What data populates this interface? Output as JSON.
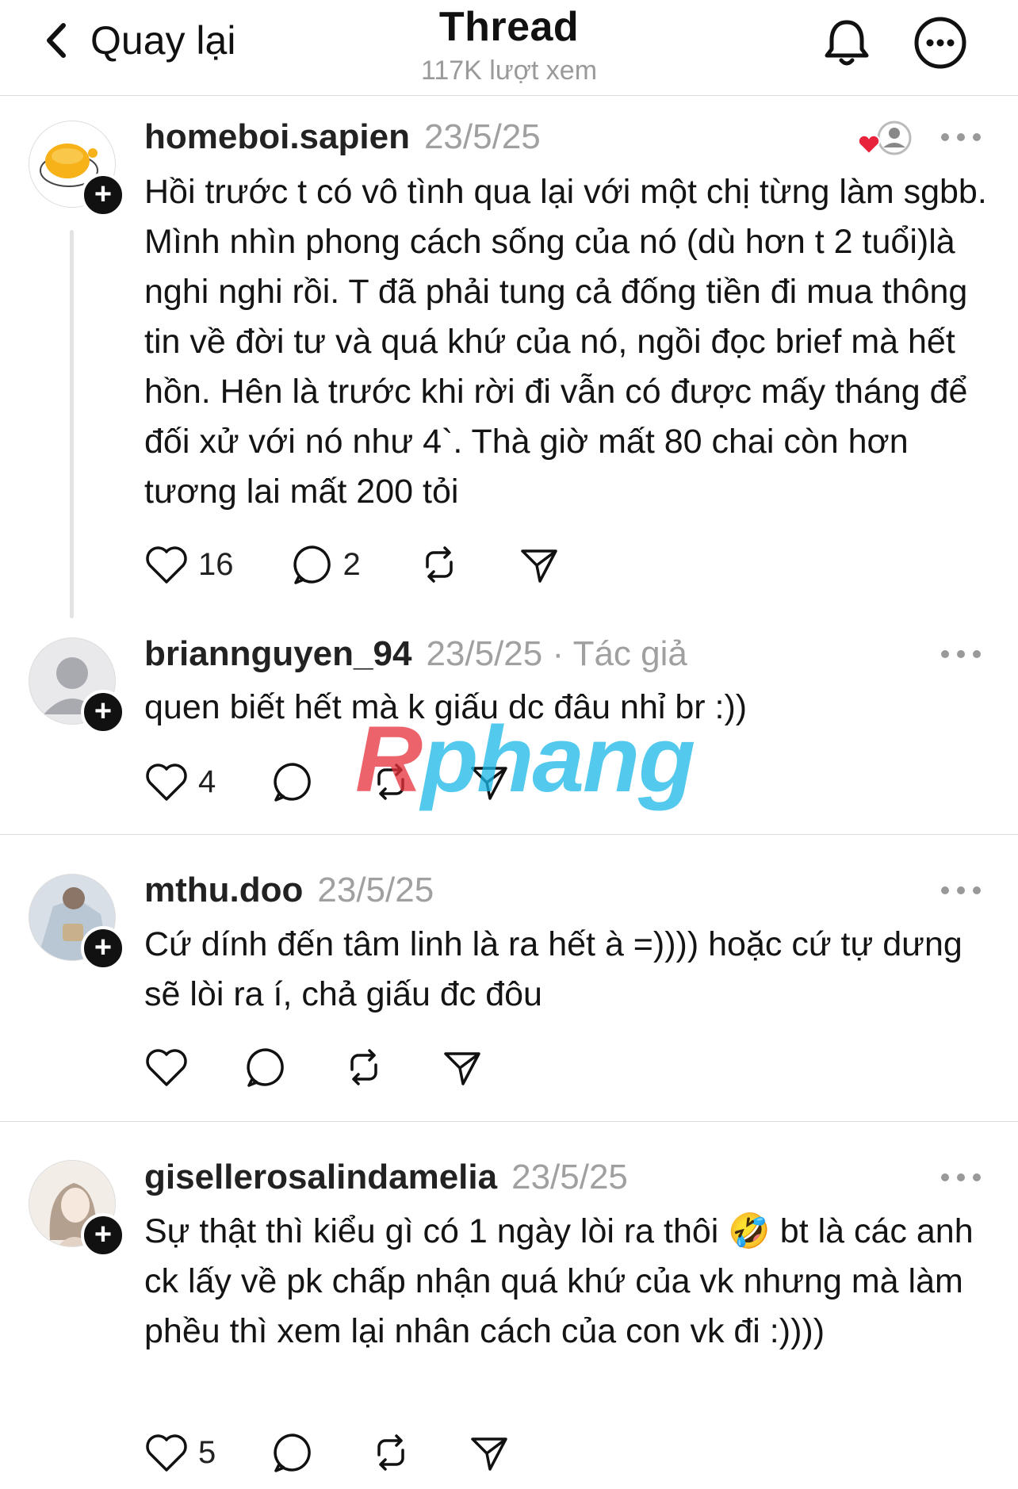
{
  "header": {
    "back_label": "Quay lại",
    "title": "Thread",
    "views": "117K lượt xem"
  },
  "watermark": {
    "part1": "R",
    "part2": "phang"
  },
  "posts": [
    {
      "username": "homeboi.sapien",
      "date": "23/5/25",
      "author_tag": "",
      "text": "Hồi trước t có vô tình qua lại với một chị từng làm sgbb. Mình nhìn phong cách sống của nó (dù hơn t 2 tuổi)là nghi nghi rồi. T đã phải tung cả đống tiền đi mua thông tin về đời tư và quá khứ của nó, ngồi đọc brief mà hết hồn. Hên là trước khi rời đi vẫn có được mấy tháng để đối xử với nó như 4`. Thà giờ mất 80 chai còn hơn tương lai mất 200 tỏi",
      "likes": "16",
      "replies": "2"
    },
    {
      "username": "briannguyen_94",
      "date": "23/5/25",
      "author_tag": "· Tác giả",
      "text": "quen biết hết mà k giấu dc đâu nhỉ br :))",
      "likes": "4",
      "replies": ""
    },
    {
      "username": "mthu.doo",
      "date": "23/5/25",
      "author_tag": "",
      "text": "Cứ dính đến tâm linh là ra hết à =)))) hoặc cứ tự dưng sẽ lòi ra í, chả giấu đc đôu",
      "likes": "",
      "replies": ""
    },
    {
      "username": "gisellerosalindamelia",
      "date": "23/5/25",
      "author_tag": "",
      "text": "Sự thật thì kiểu gì có 1 ngày lòi ra thôi 🤣 bt là các anh ck lấy về pk chấp nhận quá khứ của vk nhưng mà làm phều thì xem lại nhân cách của con vk đi :))))",
      "likes": "5",
      "replies": ""
    }
  ],
  "icons": [
    "back-chevron-icon",
    "bell-icon",
    "more-circle-icon",
    "heart-icon",
    "comment-icon",
    "repost-icon",
    "share-icon",
    "more-dots-icon",
    "plus-icon"
  ]
}
